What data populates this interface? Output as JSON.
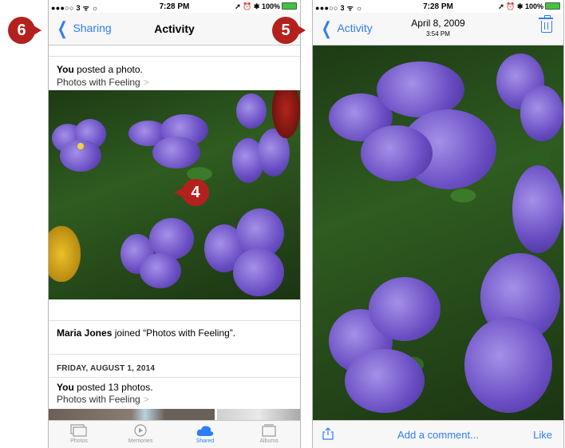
{
  "left_screen": {
    "status": {
      "carrier": "●●●○○ 3 ᯤ ☼",
      "time": "7:28 PM",
      "right": "➚ ⏰ ✱ 100%"
    },
    "nav": {
      "back_label": "Sharing",
      "title": "Activity"
    },
    "posts": [
      {
        "actor": "You",
        "text": " posted a photo.",
        "album": "Photos with Feeling"
      },
      {
        "actor": "Maria Jones",
        "text": " joined “Photos with Feeling”."
      },
      {
        "date_header": "FRIDAY, AUGUST 1, 2014"
      },
      {
        "actor": "You",
        "text": " posted 13 photos.",
        "album": "Photos with Feeling"
      }
    ],
    "tabs": [
      {
        "label": "Photos",
        "icon": "photos-icon"
      },
      {
        "label": "Memories",
        "icon": "memories-icon"
      },
      {
        "label": "Shared",
        "icon": "cloud-icon",
        "active": true
      },
      {
        "label": "Albums",
        "icon": "albums-icon"
      }
    ]
  },
  "right_screen": {
    "status": {
      "carrier": "●●●○○ 3 ᯤ ☼",
      "time": "7:28 PM",
      "right": "➚ ⏰ ✱ 100%"
    },
    "nav": {
      "back_label": "Activity",
      "date": "April 8, 2009",
      "time": "3:54 PM"
    },
    "bottom": {
      "comment_label": "Add a comment...",
      "like_label": "Like"
    }
  },
  "callouts": [
    {
      "number": "6",
      "icon": "step-6-callout"
    },
    {
      "number": "5",
      "icon": "step-5-callout"
    },
    {
      "number": "4",
      "icon": "step-4-callout"
    }
  ],
  "colors": {
    "accent": "#2f7df6",
    "callout": "#b3211e",
    "battery": "#3ec53e"
  }
}
